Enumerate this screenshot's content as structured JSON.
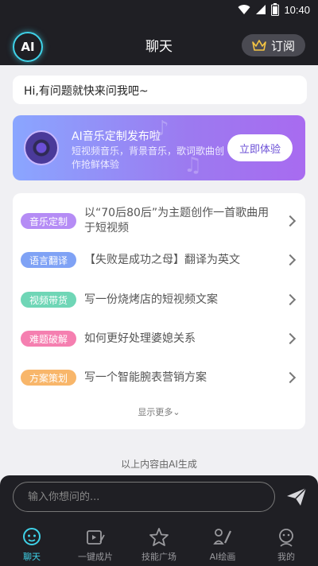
{
  "status_bar": {
    "time": "10:40",
    "icons": [
      "wifi-icon",
      "signal-icon",
      "battery-icon"
    ]
  },
  "header": {
    "logo_text": "AI",
    "title": "聊天",
    "subscribe_label": "订阅"
  },
  "greeting": "Hi,有问题就快来问我吧~",
  "banner": {
    "title": "AI音乐定制发布啦",
    "description": "短视频音乐，背景音乐，歌词歌曲创作抢鲜体验",
    "button_label": "立即体验"
  },
  "suggestions": [
    {
      "tag": "音乐定制",
      "color": "#b58cf5",
      "text": "以“70后80后”为主题创作一首歌曲用于短视频"
    },
    {
      "tag": "语言翻译",
      "color": "#7fa2f5",
      "text": "【失败是成功之母】翻译为英文"
    },
    {
      "tag": "视频带货",
      "color": "#6fd6b6",
      "text": "写一份烧烤店的短视频文案"
    },
    {
      "tag": "难题破解",
      "color": "#f57fb0",
      "text": "如何更好处理婆媳关系"
    },
    {
      "tag": "方案策划",
      "color": "#f8b66a",
      "text": "写一个智能腕表营销方案"
    }
  ],
  "show_more_label": "显示更多⌄",
  "footnote": "以上内容由AI生成",
  "input": {
    "placeholder": "输入你想问的..."
  },
  "nav": [
    {
      "label": "聊天",
      "icon": "chat-icon",
      "active": true
    },
    {
      "label": "一键成片",
      "icon": "video-edit-icon",
      "active": false
    },
    {
      "label": "技能广场",
      "icon": "star-icon",
      "active": false
    },
    {
      "label": "AI绘画",
      "icon": "paint-icon",
      "active": false
    },
    {
      "label": "我的",
      "icon": "profile-icon",
      "active": false
    }
  ]
}
